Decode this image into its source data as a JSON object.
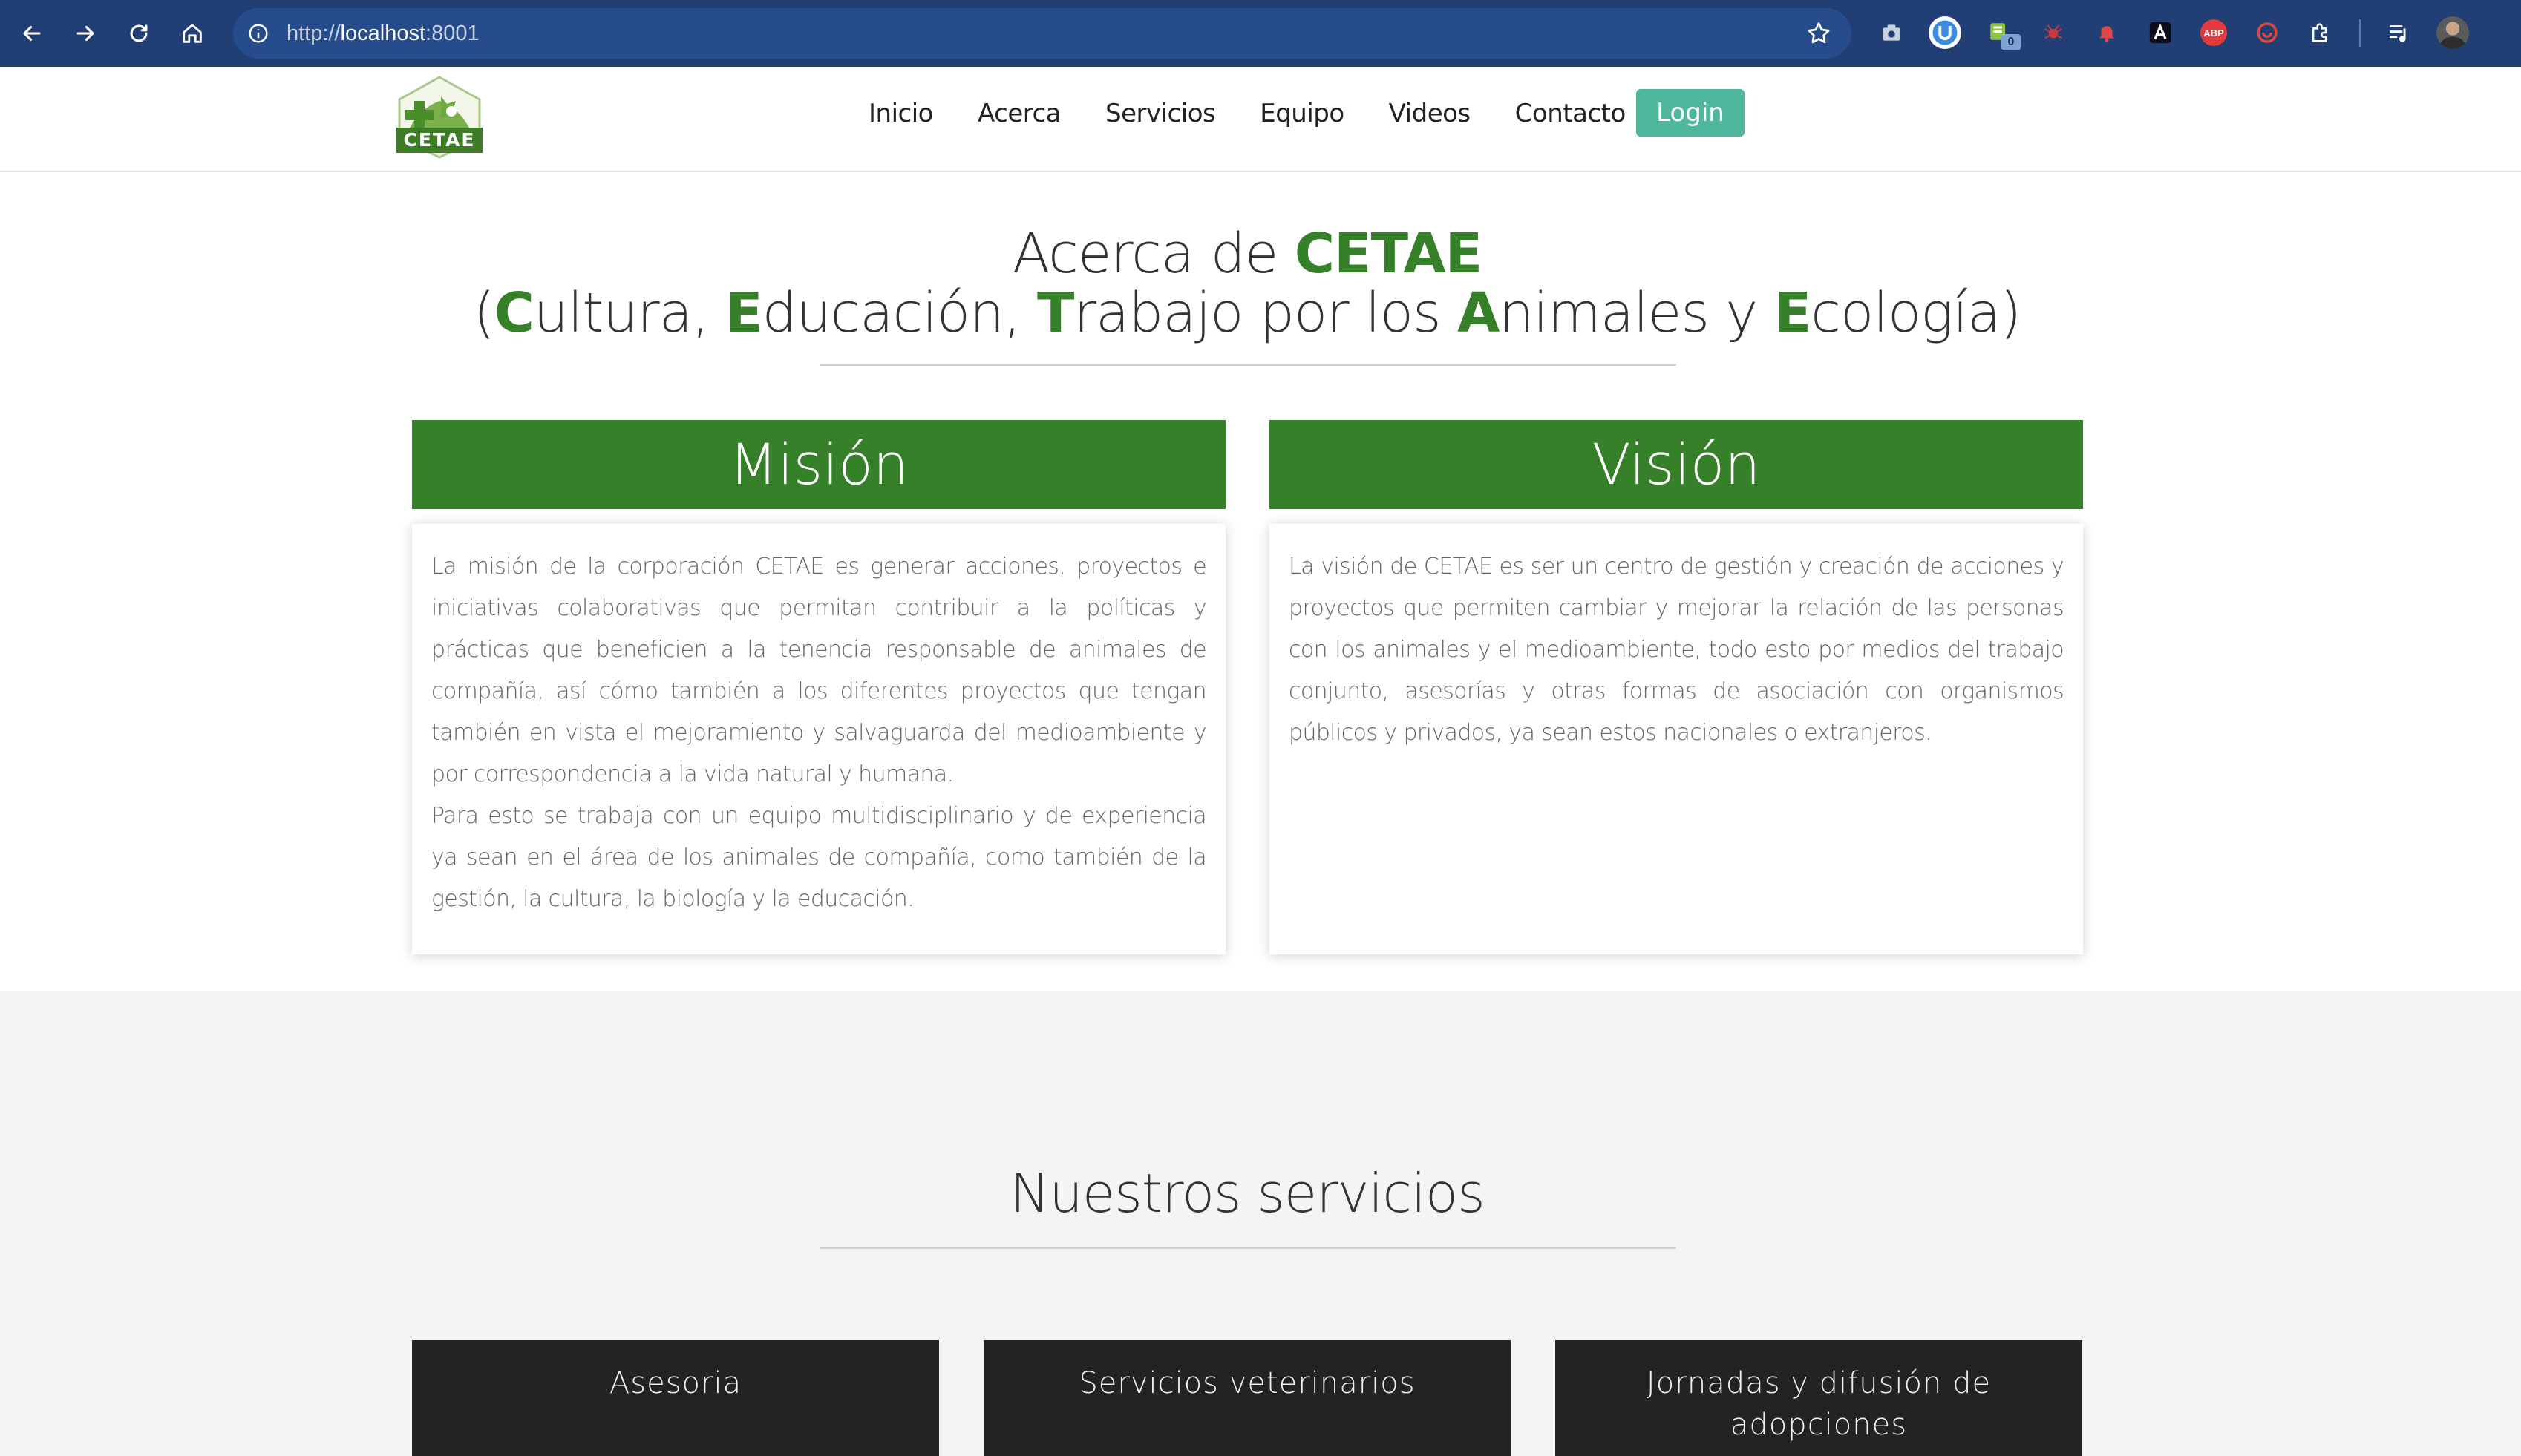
{
  "browser": {
    "url": "http://localhost:8001",
    "url_prefix": "http://",
    "url_host": "localhost",
    "url_port": ":8001",
    "extension_badge": "0",
    "extensions": [
      "screenshot-icon",
      "ublock-icon",
      "tab-counter-icon",
      "spider-icon",
      "bell-icon",
      "a-icon",
      "adblock-icon",
      "red-circle-icon",
      "puzzle-icon",
      "media-icon",
      "avatar"
    ],
    "abp_label": "ABP"
  },
  "site": {
    "logo_text": "CETAE",
    "nav": [
      "Inicio",
      "Acerca",
      "Servicios",
      "Equipo",
      "Videos",
      "Contacto"
    ],
    "login": "Login",
    "accent": "#37802a",
    "login_color": "#4fb79b"
  },
  "about": {
    "title_prefix": "Acerca de ",
    "title_brand": "CETAE",
    "subtitle": {
      "open": "(",
      "c": "C",
      "c_rest": "ultura, ",
      "e1": "E",
      "e1_rest": "ducación, ",
      "t": "T",
      "t_rest": "rabajo por los ",
      "a": "A",
      "a_rest": "nimales y ",
      "e2": "E",
      "e2_rest": "cología)"
    },
    "mission": {
      "title": "Misión",
      "p1": "La misión de la corporación CETAE es generar acciones, proyectos e iniciativas colaborativas que permitan contribuir a la políticas y prácticas que beneficien a la tenencia responsable de animales de compañía, así cómo también a los diferentes proyectos que tengan también en vista el mejoramiento y salvaguarda del medioambiente y por correspondencia a la vida natural y humana.",
      "p2": "Para esto se trabaja con un equipo multidisciplinario y de experiencia ya sean en el área de los animales de compañía, como también de la gestión, la cultura, la biología y la educación."
    },
    "vision": {
      "title": "Visión",
      "p1": "La visión de CETAE es ser un centro de gestión y creación de acciones y proyectos que permiten cambiar y mejorar la relación de las personas con los animales y el medioambiente, todo esto por medios del trabajo conjunto, asesorías y otras formas de asociación con organismos públicos y privados, ya sean estos nacionales o extranjeros."
    }
  },
  "services": {
    "title": "Nuestros servicios",
    "items": [
      "Asesoria",
      "Servicios veterinarios",
      "Jornadas y difusión de adopciones"
    ]
  }
}
